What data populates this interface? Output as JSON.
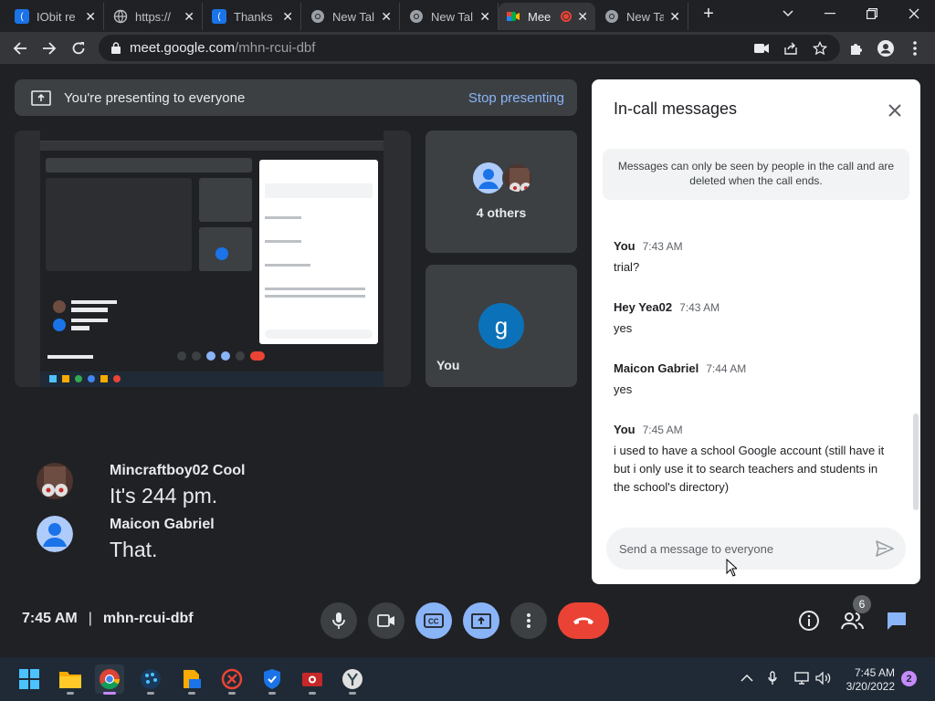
{
  "browser": {
    "tabs": [
      {
        "title": "IObit re",
        "icon": "iobit-icon",
        "color": "#1a73e8"
      },
      {
        "title": "https://",
        "icon": "globe-icon",
        "color": "#5f6368"
      },
      {
        "title": "Thanks",
        "icon": "iobit-icon",
        "color": "#1a73e8"
      },
      {
        "title": "New Tal",
        "icon": "chrome-icon",
        "color": "#9aa0a6"
      },
      {
        "title": "New Tal",
        "icon": "chrome-icon",
        "color": "#9aa0a6"
      },
      {
        "title": "Mee",
        "icon": "meet-icon",
        "color": "#00ac47",
        "active": true
      },
      {
        "title": "New Ta",
        "icon": "chrome-icon",
        "color": "#9aa0a6"
      }
    ],
    "url_host": "meet.google.com",
    "url_path": "/mhn-rcui-dbf"
  },
  "presenting": {
    "label": "You're presenting to everyone",
    "stop": "Stop presenting"
  },
  "tiles": {
    "others_label": "4 others",
    "you_label": "You",
    "you_initial": "g"
  },
  "captions": [
    {
      "name": "Mincraftboy02 Cool",
      "text": "It's 244 pm."
    },
    {
      "name": "Maicon Gabriel",
      "text": "That."
    }
  ],
  "chat": {
    "title": "In-call messages",
    "notice": "Messages can only be seen by people in the call and are deleted when the call ends.",
    "messages": [
      {
        "sender": "You",
        "time": "7:43 AM",
        "text": "trial?"
      },
      {
        "sender": "Hey Yea02",
        "time": "7:43 AM",
        "text": "yes"
      },
      {
        "sender": "Maicon Gabriel",
        "time": "7:44 AM",
        "text": "yes"
      },
      {
        "sender": "You",
        "time": "7:45 AM",
        "text": "i used to have a school Google account (still have it but i only use it to search teachers and students in the school's directory)"
      }
    ],
    "placeholder": "Send a message to everyone"
  },
  "meetbar": {
    "time": "7:45 AM",
    "code": "mhn-rcui-dbf",
    "people_count": "6"
  },
  "taskbar": {
    "time": "7:45 AM",
    "date": "3/20/2022",
    "notifications": "2"
  },
  "colors": {
    "accent": "#8ab4f8",
    "end_call": "#ea4335",
    "panel": "#3c4043"
  }
}
